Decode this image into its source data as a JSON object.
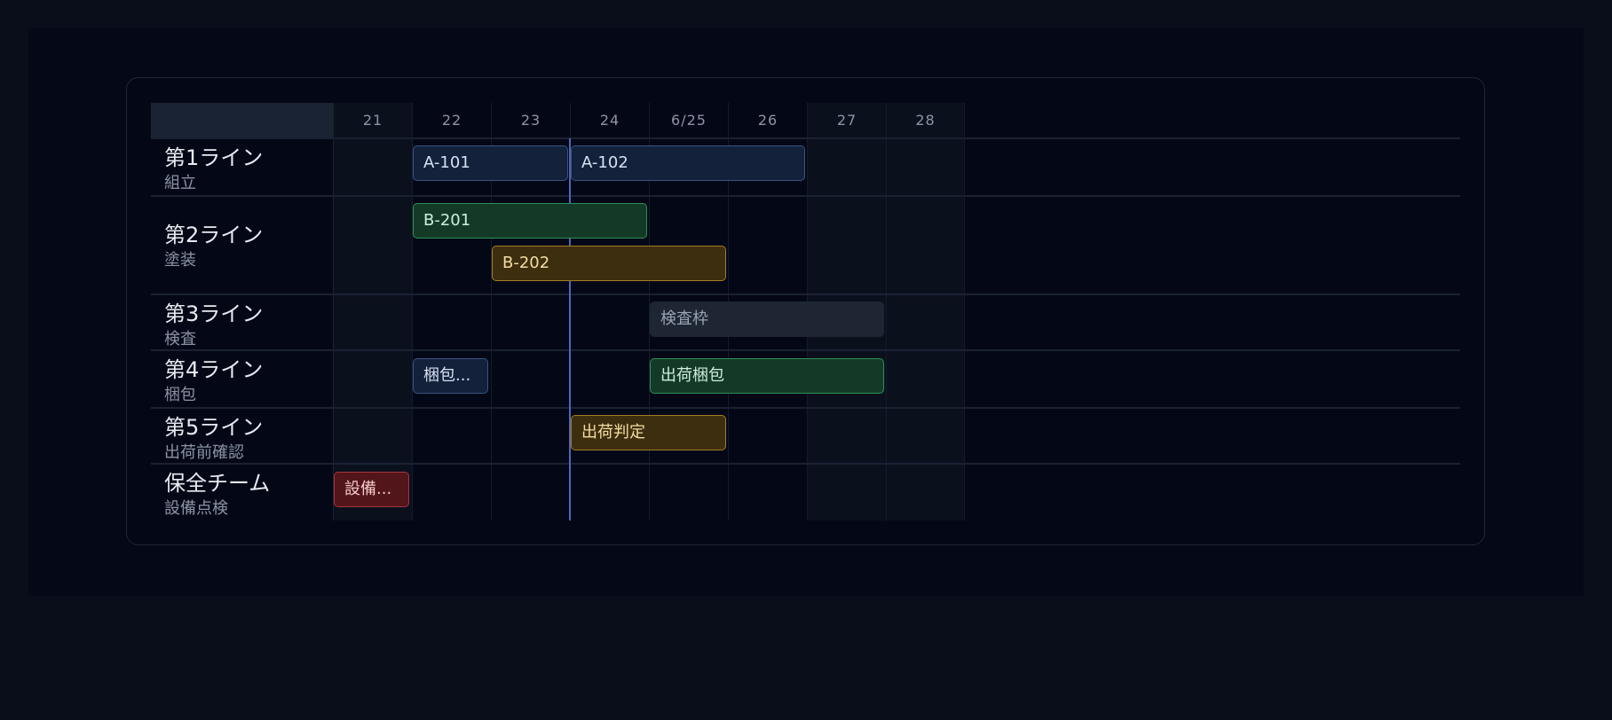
{
  "timeline": {
    "days": [
      "21",
      "22",
      "23",
      "24",
      "6/25",
      "26",
      "27",
      "28"
    ],
    "today_index": 3
  },
  "rows": [
    {
      "name": "第1ライン",
      "sub": "組立"
    },
    {
      "name": "第2ライン",
      "sub": "塗装"
    },
    {
      "name": "第3ライン",
      "sub": "検査"
    },
    {
      "name": "第4ライン",
      "sub": "梱包"
    },
    {
      "name": "第5ライン",
      "sub": "出荷前確認"
    },
    {
      "name": "保全チーム",
      "sub": "設備点検"
    }
  ],
  "tasks": [
    {
      "label": "A-101",
      "row": 0,
      "color": "blue"
    },
    {
      "label": "A-102",
      "row": 0,
      "color": "blue"
    },
    {
      "label": "B-201",
      "row": 1,
      "color": "green"
    },
    {
      "label": "B-202",
      "row": 1,
      "color": "amber"
    },
    {
      "label": "検査枠",
      "row": 2,
      "color": "gray"
    },
    {
      "label": "梱包...",
      "row": 3,
      "color": "blue"
    },
    {
      "label": "出荷梱包",
      "row": 3,
      "color": "green"
    },
    {
      "label": "出荷判定",
      "row": 4,
      "color": "amber"
    },
    {
      "label": "設備...",
      "row": 5,
      "color": "red"
    }
  ],
  "colors": {
    "blue": "#13213b",
    "green": "#143a27",
    "amber": "#3e2e10",
    "gray": "#1e2533",
    "red": "#521519",
    "today_line": "#4f67b8"
  }
}
